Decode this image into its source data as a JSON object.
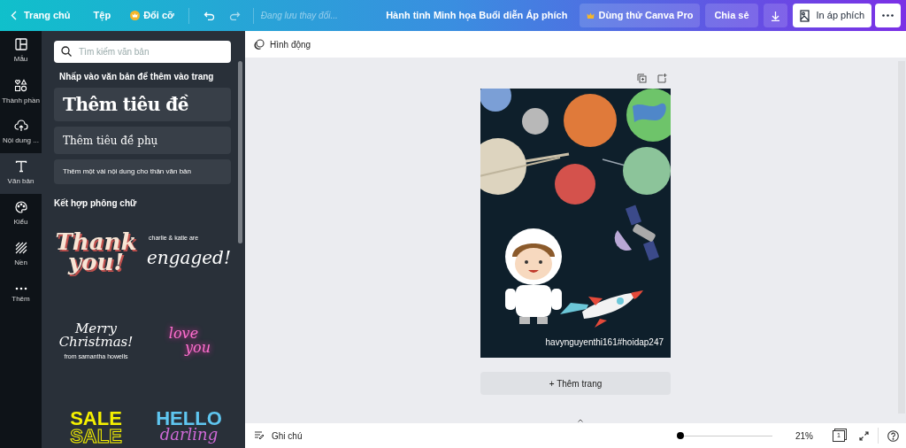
{
  "topbar": {
    "home": "Trang chủ",
    "file": "Tệp",
    "resize": "Đổi cỡ",
    "save_status": "Đang lưu thay đổi...",
    "title": "Hành tinh Minh họa Buổi diễn Áp phích",
    "pro": "Dùng thử Canva Pro",
    "share": "Chia sẻ",
    "print": "In áp phích"
  },
  "sidebar": {
    "items": [
      {
        "label": "Mẫu",
        "kind": "layout",
        "selected": false
      },
      {
        "label": "Thành phần",
        "kind": "shapes",
        "selected": false
      },
      {
        "label": "Nội dung ...",
        "kind": "upload",
        "selected": false
      },
      {
        "label": "Văn bản",
        "kind": "text",
        "selected": true
      },
      {
        "label": "Kiểu",
        "kind": "palette",
        "selected": false
      },
      {
        "label": "Nền",
        "kind": "stripes",
        "selected": false
      },
      {
        "label": "Thêm",
        "kind": "dots",
        "selected": false
      }
    ]
  },
  "panel": {
    "search": {
      "placeholder": "Tìm kiếm văn bản"
    },
    "hint": "Nhấp vào văn bản để thêm vào trang",
    "presets": [
      {
        "kind": "heading",
        "text": "Thêm tiêu đề"
      },
      {
        "kind": "subheading",
        "text": "Thêm tiêu đề phụ"
      },
      {
        "kind": "body",
        "text": "Thêm một vài nội dung cho thân văn bản"
      }
    ],
    "combos_title": "Kết hợp phông chữ",
    "combos": [
      {
        "kind": "thankyou",
        "lines": [
          "Thank",
          "you!"
        ]
      },
      {
        "kind": "engaged",
        "lines": [
          "charlie & katie are",
          "engaged!"
        ]
      },
      {
        "kind": "christmas",
        "lines": [
          "Merry",
          "Christmas!",
          "from samantha howells"
        ]
      },
      {
        "kind": "love",
        "lines": [
          "love",
          "you"
        ]
      },
      {
        "kind": "sale",
        "lines": [
          "SALE",
          "SALE"
        ]
      },
      {
        "kind": "hello",
        "lines": [
          "HELLO",
          "darling"
        ]
      }
    ]
  },
  "toolbar": {
    "animate": "Hình động"
  },
  "poster": {
    "caption": "havynguyenthi161#hoidap247"
  },
  "add_page": "+ Thêm trang",
  "bottom": {
    "notes": "Ghi chú",
    "zoom": {
      "level": 0
    },
    "zoom_reading": "21%",
    "page_count": "1"
  }
}
